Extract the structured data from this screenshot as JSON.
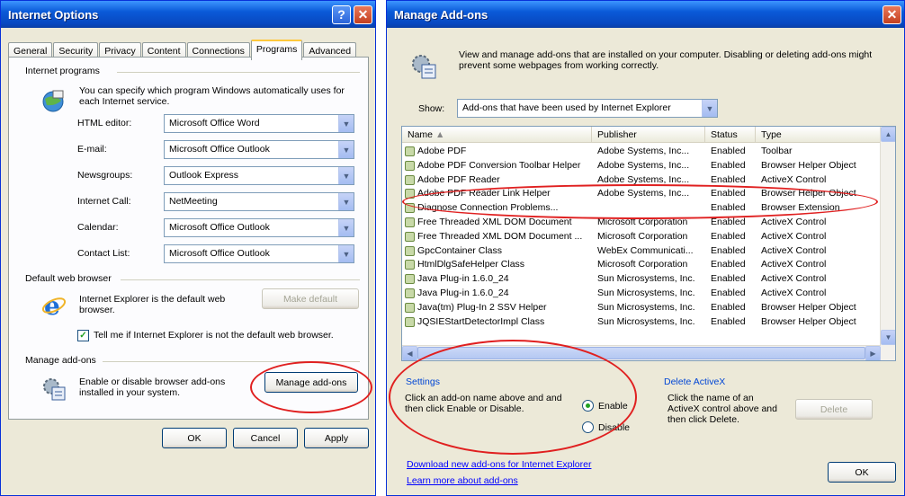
{
  "internet_options": {
    "title": "Internet Options",
    "tabs": [
      "General",
      "Security",
      "Privacy",
      "Content",
      "Connections",
      "Programs",
      "Advanced"
    ],
    "active_tab": "Programs",
    "internet_programs": {
      "group_label": "Internet programs",
      "description": "You can specify which program Windows automatically uses for each Internet service.",
      "rows": [
        {
          "label": "HTML editor:",
          "value": "Microsoft Office Word"
        },
        {
          "label": "E-mail:",
          "value": "Microsoft Office Outlook"
        },
        {
          "label": "Newsgroups:",
          "value": "Outlook Express"
        },
        {
          "label": "Internet Call:",
          "value": "NetMeeting"
        },
        {
          "label": "Calendar:",
          "value": "Microsoft Office Outlook"
        },
        {
          "label": "Contact List:",
          "value": "Microsoft Office Outlook"
        }
      ]
    },
    "default_browser": {
      "group_label": "Default web browser",
      "description": "Internet Explorer is the default web browser.",
      "make_default_label": "Make default",
      "checkbox_label": "Tell me if Internet Explorer is not the default web browser."
    },
    "manage_addons": {
      "group_label": "Manage add-ons",
      "description": "Enable or disable browser add-ons installed in your system.",
      "button_label": "Manage add-ons"
    },
    "buttons": {
      "ok": "OK",
      "cancel": "Cancel",
      "apply": "Apply"
    }
  },
  "manage_addons_dialog": {
    "title": "Manage Add-ons",
    "intro": "View and manage add-ons that are installed on your computer. Disabling or deleting add-ons might prevent some webpages from working correctly.",
    "show_label": "Show:",
    "show_value": "Add-ons that have been used by Internet Explorer",
    "columns": {
      "name": "Name",
      "publisher": "Publisher",
      "status": "Status",
      "type": "Type"
    },
    "rows": [
      {
        "name": "Adobe PDF",
        "publisher": "Adobe Systems, Inc...",
        "status": "Enabled",
        "type": "Toolbar"
      },
      {
        "name": "Adobe PDF Conversion Toolbar Helper",
        "publisher": "Adobe Systems, Inc...",
        "status": "Enabled",
        "type": "Browser Helper Object"
      },
      {
        "name": "Adobe PDF Reader",
        "publisher": "Adobe Systems, Inc...",
        "status": "Enabled",
        "type": "ActiveX Control"
      },
      {
        "name": "Adobe PDF Reader Link Helper",
        "publisher": "Adobe Systems, Inc...",
        "status": "Enabled",
        "type": "Browser Helper Object"
      },
      {
        "name": "Diagnose Connection Problems...",
        "publisher": "",
        "status": "Enabled",
        "type": "Browser Extension"
      },
      {
        "name": "Free Threaded XML DOM Document",
        "publisher": "Microsoft Corporation",
        "status": "Enabled",
        "type": "ActiveX Control"
      },
      {
        "name": "Free Threaded XML DOM Document ...",
        "publisher": "Microsoft Corporation",
        "status": "Enabled",
        "type": "ActiveX Control"
      },
      {
        "name": "GpcContainer Class",
        "publisher": "WebEx Communicati...",
        "status": "Enabled",
        "type": "ActiveX Control"
      },
      {
        "name": "HtmlDlgSafeHelper Class",
        "publisher": "Microsoft Corporation",
        "status": "Enabled",
        "type": "ActiveX Control"
      },
      {
        "name": "Java Plug-in 1.6.0_24",
        "publisher": "Sun Microsystems, Inc.",
        "status": "Enabled",
        "type": "ActiveX Control"
      },
      {
        "name": "Java Plug-in 1.6.0_24",
        "publisher": "Sun Microsystems, Inc.",
        "status": "Enabled",
        "type": "ActiveX Control"
      },
      {
        "name": "Java(tm) Plug-In 2 SSV Helper",
        "publisher": "Sun Microsystems, Inc.",
        "status": "Enabled",
        "type": "Browser Helper Object"
      },
      {
        "name": "JQSIEStartDetectorImpl Class",
        "publisher": "Sun Microsystems, Inc.",
        "status": "Enabled",
        "type": "Browser Helper Object"
      }
    ],
    "settings": {
      "group_label": "Settings",
      "description": "Click an add-on name above and and then click Enable or Disable.",
      "enable_label": "Enable",
      "disable_label": "Disable",
      "selected": "Enable"
    },
    "delete_activex": {
      "group_label": "Delete ActiveX",
      "description": "Click the name of an ActiveX control above and then click Delete.",
      "delete_label": "Delete"
    },
    "links": {
      "download": "Download new add-ons for Internet Explorer",
      "learn_more": "Learn more about add-ons"
    },
    "ok_label": "OK"
  },
  "colors": {
    "title_bar": "#0a5ad8",
    "highlight_ring": "#e02020",
    "group_label_blue": "#0046d5"
  }
}
